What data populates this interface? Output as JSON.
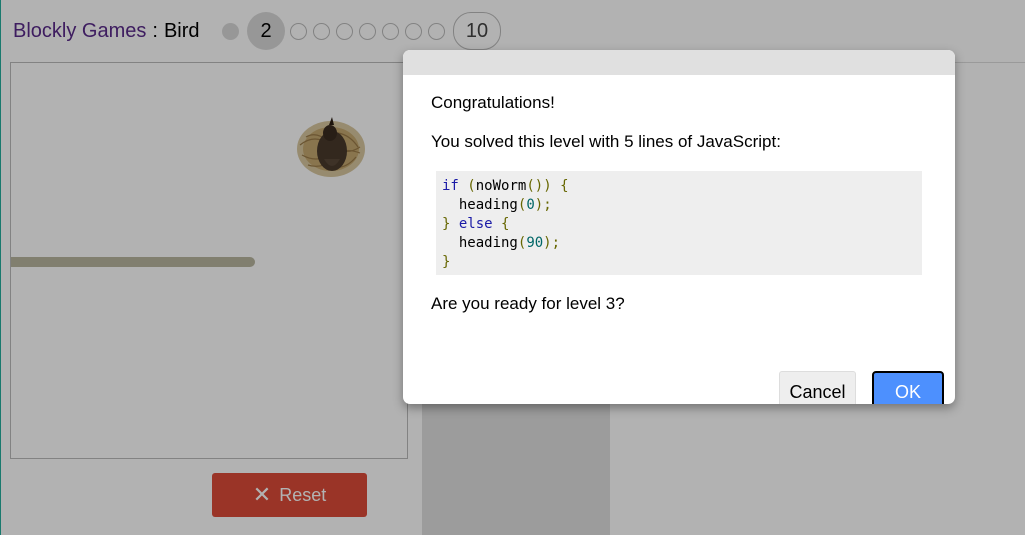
{
  "header": {
    "app_name": "Blockly Games",
    "separator": ":",
    "game_name": "Bird"
  },
  "levels": {
    "current": "2",
    "last": "10"
  },
  "viz": {
    "nest_icon": "bird-in-nest-icon"
  },
  "reset_button": {
    "label": "Reset",
    "icon": "✕"
  },
  "dialog": {
    "line1": "Congratulations!",
    "line2": "You solved this level with 5 lines of JavaScript:",
    "code_lines": [
      "if (noWorm()) {",
      "  heading(0);",
      "} else {",
      "  heading(90);",
      "}"
    ],
    "line3": "Are you ready for level 3?",
    "cancel_label": "Cancel",
    "ok_label": "OK"
  },
  "colors": {
    "accent": "#4d90fe",
    "reset": "#dd4b39",
    "title": "#5a2a8a"
  }
}
